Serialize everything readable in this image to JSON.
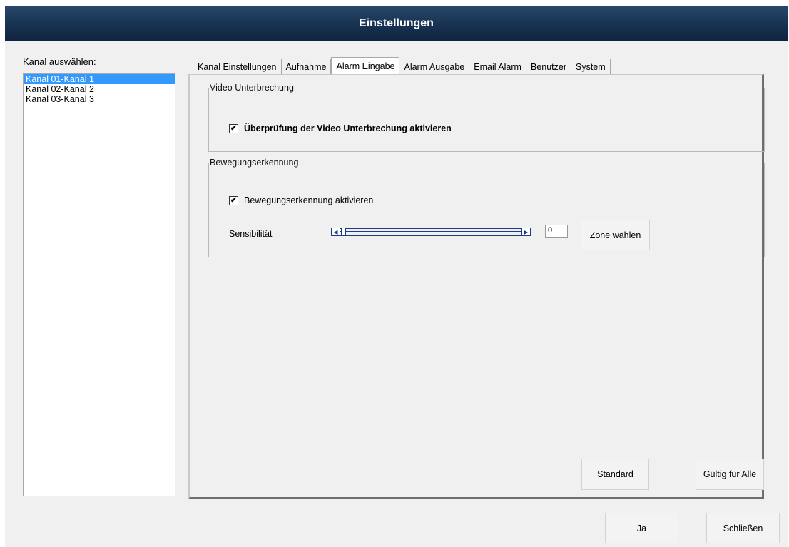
{
  "window": {
    "title": "Einstellungen"
  },
  "channels": {
    "label": "Kanal auswählen:",
    "items": [
      "Kanal 01-Kanal 1",
      "Kanal 02-Kanal 2",
      "Kanal 03-Kanal 3"
    ],
    "selected_index": 0
  },
  "tabs": [
    "Kanal Einstellungen",
    "Aufnahme",
    "Alarm Eingabe",
    "Alarm Ausgabe",
    "Email Alarm",
    "Benutzer",
    "System"
  ],
  "active_tab": "Alarm Eingabe",
  "video_loss": {
    "legend": "Video Unterbrechung",
    "checkbox_label": "Überprüfung der Video Unterbrechung aktivieren",
    "checked": true
  },
  "motion": {
    "legend": "Bewegungserkennung",
    "checkbox_label": "Bewegungserkennung aktivieren",
    "checked": true,
    "sensitivity_label": "Sensibilität",
    "sensitivity_value": "0",
    "zone_button": "Zone wählen"
  },
  "panel_buttons": {
    "standard": "Standard",
    "apply_all": "Gültig für Alle"
  },
  "footer_buttons": {
    "ok": "Ja",
    "close": "Schließen"
  },
  "colors": {
    "titlebar": "#1a3555",
    "selection": "#3399ff",
    "slider": "#1a3a8a"
  }
}
